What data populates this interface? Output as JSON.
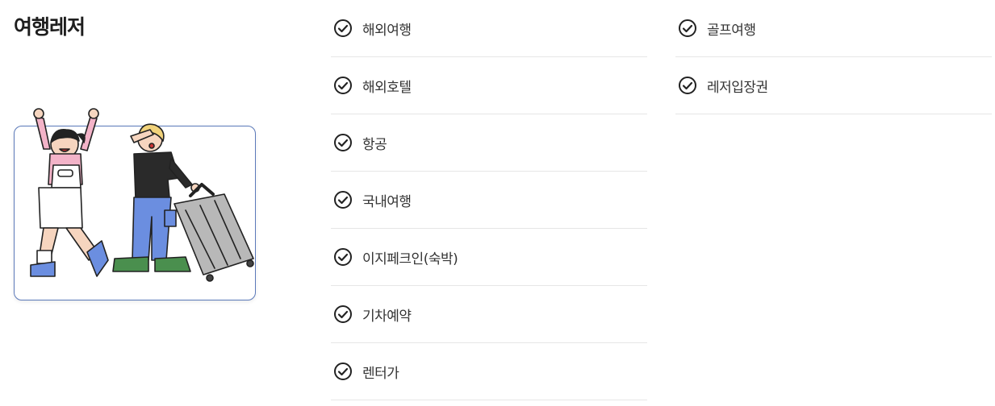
{
  "section": {
    "title": "여행레저"
  },
  "menu": {
    "column1": [
      {
        "label": "해외여행"
      },
      {
        "label": "해외호텔"
      },
      {
        "label": "항공"
      },
      {
        "label": "국내여행"
      },
      {
        "label": "이지페크인(숙박)"
      },
      {
        "label": "기차예약"
      },
      {
        "label": "렌터가"
      }
    ],
    "column2": [
      {
        "label": "골프여행"
      },
      {
        "label": "레저입장권"
      }
    ]
  },
  "icons": {
    "item_icon": "check-circle-icon",
    "banner": "travelers-illustration"
  },
  "colors": {
    "accent_border": "#5b79b9",
    "divider": "#e6e6e6",
    "text": "#333333"
  }
}
